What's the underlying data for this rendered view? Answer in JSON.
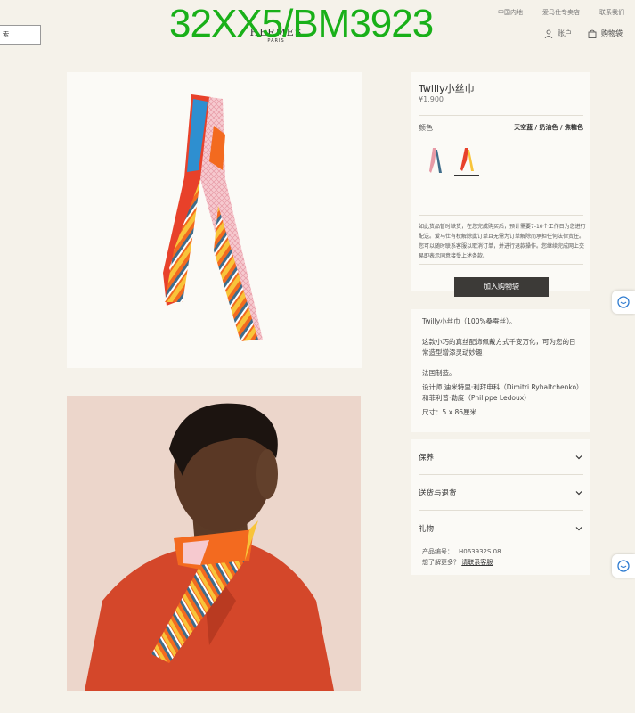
{
  "header": {
    "search_text": "索",
    "brand_name": "HERMES",
    "brand_sub": "PARIS",
    "watermark": "32XX5/BM3923",
    "top_links": [
      "中国内地",
      "爱马仕专卖店",
      "联系我们"
    ],
    "account_label": "账户",
    "cart_label": "购物袋"
  },
  "product": {
    "title": "Twilly小丝巾",
    "price": "¥1,900",
    "color_label": "颜色",
    "color_value": "天空蓝 / 奶油色 / 焦糖色",
    "notice": "如此货品暂时缺货，在您完成购买后，预计需要7-10个工作日为您进行配送。爱马仕有权解除此订单且无需为订单解除而承担任何法律责任。您可以随时联系客服以取消订单，并进行退款操作。您继续完成网上交易即表示同意接受上述条款。",
    "add_to_bag": "加入购物袋"
  },
  "info": {
    "line1": "Twilly小丝巾（100%桑蚕丝）。",
    "line2": "这款小巧的真丝配饰佩戴方式千变万化，可为您的日常造型增添灵动妙趣！",
    "line3": "法国制造。",
    "line4": "设计师 迪米特里·利拜申科（Dimitri Rybaltchenko）和菲利普·勒度（Philippe Ledoux）",
    "line5": "尺寸：5 x 86厘米"
  },
  "accordion": {
    "items": [
      "保养",
      "送货与退货",
      "礼物"
    ],
    "product_code_label": "产品编号：",
    "product_code": "H063932S 08",
    "more_label": "想了解更多？",
    "contact_link": "请联系客服"
  },
  "colors": {
    "accent_dark": "#3c3a37",
    "watermark_green": "#19b019",
    "page_bg": "#f5f2ea"
  }
}
